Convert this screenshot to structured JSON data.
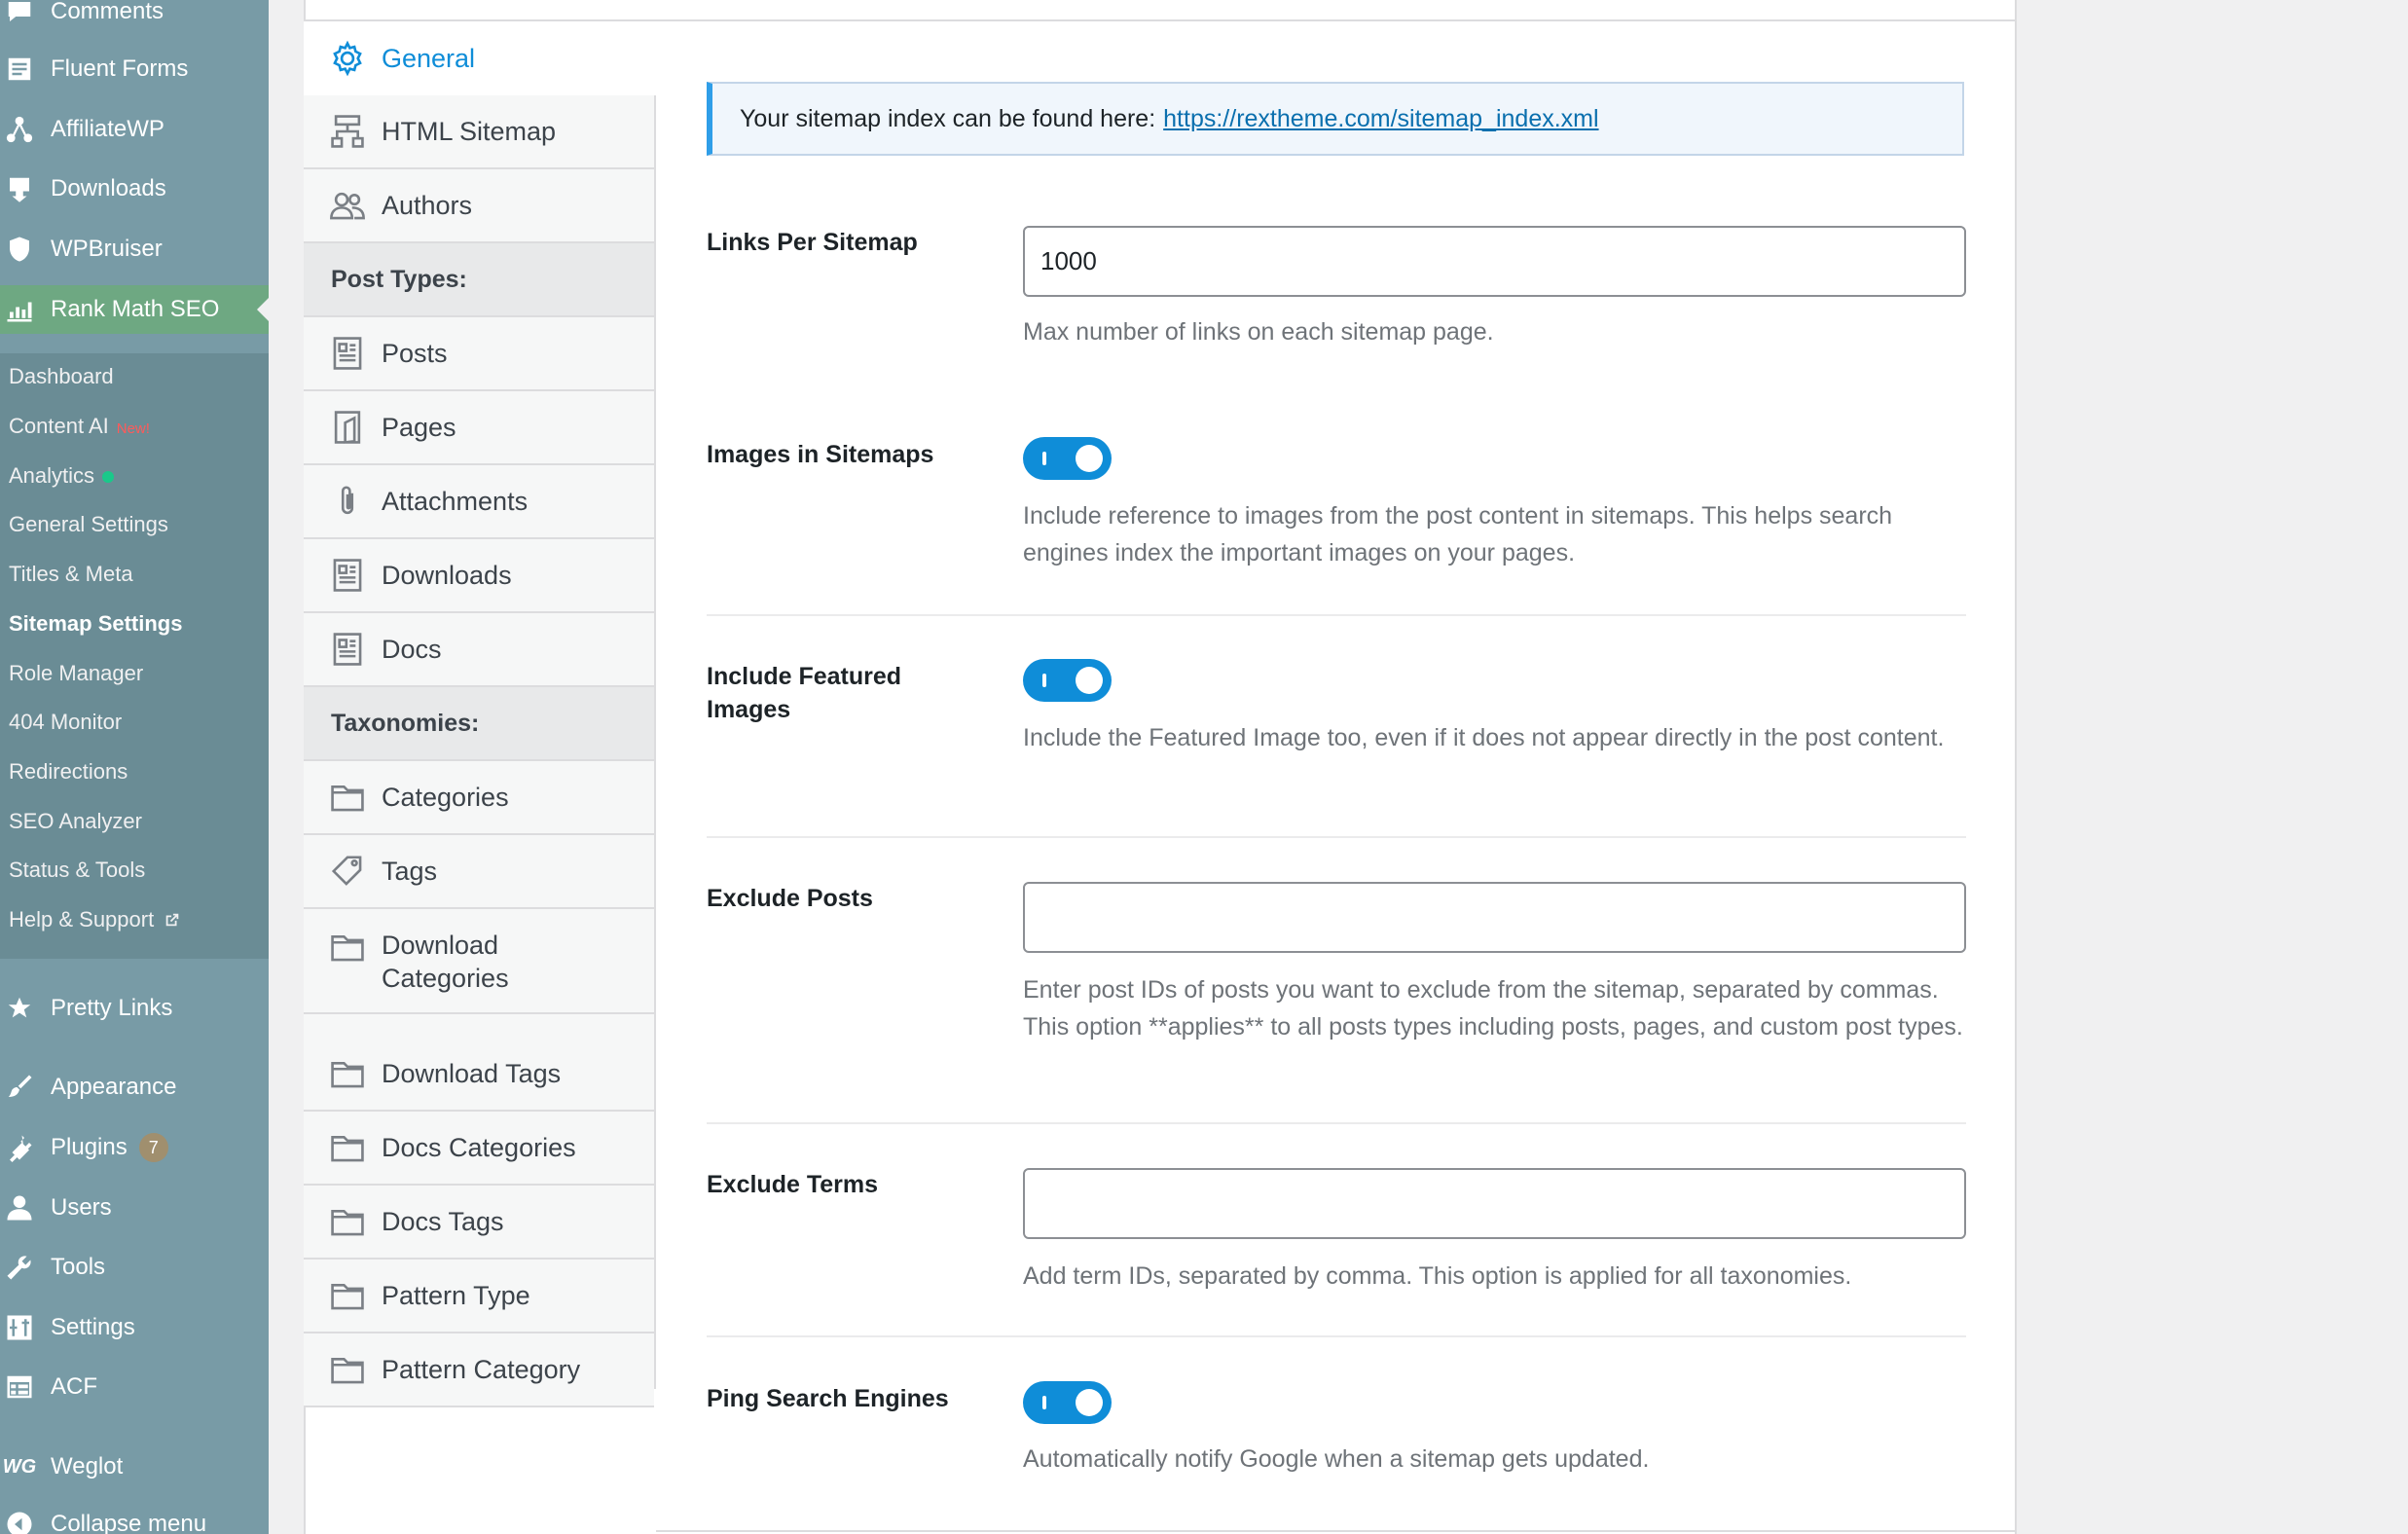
{
  "admin_menu": {
    "top_items": [
      {
        "label": "Comments",
        "icon": "comments-icon"
      },
      {
        "label": "Fluent Forms",
        "icon": "forms-icon"
      },
      {
        "label": "AffiliateWP",
        "icon": "affiliate-icon"
      },
      {
        "label": "Downloads",
        "icon": "downloads-icon"
      },
      {
        "label": "WPBruiser",
        "icon": "shield-icon"
      },
      {
        "label": "Rank Math SEO",
        "icon": "rankmath-icon"
      }
    ],
    "submenu": [
      {
        "label": "Dashboard"
      },
      {
        "label": "Content AI",
        "tag": "New!"
      },
      {
        "label": "Analytics"
      },
      {
        "label": "General Settings"
      },
      {
        "label": "Titles & Meta"
      },
      {
        "label": "Sitemap Settings"
      },
      {
        "label": "Role Manager"
      },
      {
        "label": "404 Monitor"
      },
      {
        "label": "Redirections"
      },
      {
        "label": "SEO Analyzer"
      },
      {
        "label": "Status & Tools"
      },
      {
        "label": "Help & Support"
      }
    ],
    "bottom_items": [
      {
        "label": "Pretty Links",
        "icon": "star-icon"
      },
      {
        "label": "Appearance",
        "icon": "brush-icon"
      },
      {
        "label": "Plugins",
        "icon": "plugin-icon",
        "badge": "7"
      },
      {
        "label": "Users",
        "icon": "user-icon"
      },
      {
        "label": "Tools",
        "icon": "wrench-icon"
      },
      {
        "label": "Settings",
        "icon": "settings-icon"
      },
      {
        "label": "ACF",
        "icon": "acf-icon"
      },
      {
        "label": "Weglot",
        "icon": "weglot-icon"
      },
      {
        "label": "Collapse menu",
        "icon": "collapse-icon"
      }
    ]
  },
  "tabs": [
    {
      "label": "General",
      "icon": "gear-icon",
      "active": true
    },
    {
      "label": "HTML Sitemap",
      "icon": "sitemap-icon"
    },
    {
      "label": "Authors",
      "icon": "users-icon"
    },
    {
      "label": "Post Types:",
      "heading": true
    },
    {
      "label": "Posts",
      "icon": "document-icon"
    },
    {
      "label": "Pages",
      "icon": "page-icon"
    },
    {
      "label": "Attachments",
      "icon": "paperclip-icon"
    },
    {
      "label": "Downloads",
      "icon": "document-icon"
    },
    {
      "label": "Docs",
      "icon": "document-icon"
    },
    {
      "label": "Taxonomies:",
      "heading": true
    },
    {
      "label": "Categories",
      "icon": "folder-icon"
    },
    {
      "label": "Tags",
      "icon": "tag-icon"
    },
    {
      "label": "Download Categories",
      "icon": "folder-icon"
    },
    {
      "label": "Download Tags",
      "icon": "folder-icon"
    },
    {
      "label": "Docs Categories",
      "icon": "folder-icon"
    },
    {
      "label": "Docs Tags",
      "icon": "folder-icon"
    },
    {
      "label": "Pattern Type",
      "icon": "folder-icon"
    },
    {
      "label": "Pattern Category",
      "icon": "folder-icon"
    }
  ],
  "notice": {
    "text": "Your sitemap index can be found here:",
    "link": "https://rextheme.com/sitemap_index.xml"
  },
  "fields": {
    "links_per_sitemap": {
      "label": "Links Per Sitemap",
      "value": "1000",
      "description": "Max number of links on each sitemap page."
    },
    "images_in_sitemaps": {
      "label": "Images in Sitemaps",
      "enabled": true,
      "description": "Include reference to images from the post content in sitemaps. This helps search engines index the important images on your pages."
    },
    "include_featured_images": {
      "label": "Include Featured Images",
      "enabled": true,
      "description": "Include the Featured Image too, even if it does not appear directly in the post content."
    },
    "exclude_posts": {
      "label": "Exclude Posts",
      "value": "",
      "description": "Enter post IDs of posts you want to exclude from the sitemap, separated by commas. This option **applies** to all posts types including posts, pages, and custom post types."
    },
    "exclude_terms": {
      "label": "Exclude Terms",
      "value": "",
      "description": "Add term IDs, separated by comma. This option is applied for all taxonomies."
    },
    "ping_search_engines": {
      "label": "Ping Search Engines",
      "enabled": true,
      "description": "Automatically notify Google when a sitemap gets updated."
    }
  },
  "colors": {
    "accent": "#0f8dd8",
    "sidebar": "#789ba6",
    "current_menu": "#6ea882"
  }
}
